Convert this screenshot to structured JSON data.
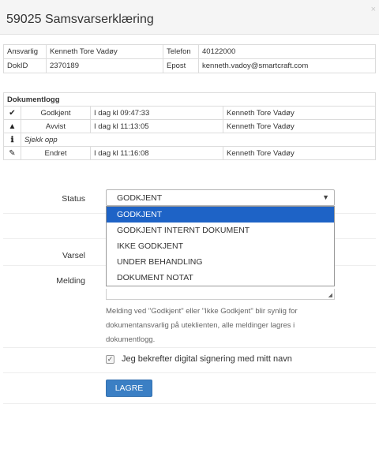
{
  "modal": {
    "title": "59025 Samsvarserklæring",
    "close": "×"
  },
  "info": {
    "responsible_label": "Ansvarlig",
    "responsible_value": "Kenneth Tore Vadøy",
    "phone_label": "Telefon",
    "phone_value": "40122000",
    "docid_label": "DokID",
    "docid_value": "2370189",
    "email_label": "Epost",
    "email_value": "kenneth.vadoy@smartcraft.com"
  },
  "log": {
    "header": "Dokumentlogg",
    "entries": [
      {
        "icon": "checkmark-icon",
        "glyph": "✔",
        "action": "Godkjent",
        "when": "I dag kl 09:47:33",
        "user": "Kenneth Tore Vadøy"
      },
      {
        "icon": "warning-icon",
        "glyph": "▲",
        "action": "Avvist",
        "when": "I dag kl 11:13:05",
        "user": "Kenneth Tore Vadøy"
      },
      {
        "icon": "info-icon",
        "glyph": "ℹ",
        "note": "Sjekk opp"
      },
      {
        "icon": "edit-icon",
        "glyph": "✎",
        "action": "Endret",
        "when": "I dag kl 11:16:08",
        "user": "Kenneth Tore Vadøy"
      }
    ]
  },
  "form": {
    "status_label": "Status",
    "status_value": "GODKJENT",
    "status_options": [
      "GODKJENT",
      "GODKJENT INTERNT DOKUMENT",
      "IKKE GODKJENT",
      "UNDER BEHANDLING",
      "DOKUMENT NOTAT"
    ],
    "varsel_label": "Varsel",
    "message_label": "Melding",
    "help_text": "Melding ved \"Godkjent\" eller \"Ikke Godkjent\" blir synlig for dokumentansvarlig på uteklienten, alle meldinger lagres i dokumentlogg.",
    "confirm_label": "Jeg bekrefter digital signering med mitt navn",
    "confirm_checked": true,
    "save_label": "LAGRE"
  },
  "colors": {
    "primary_button": "#3b7fc4",
    "dropdown_selected": "#1e63c6"
  }
}
